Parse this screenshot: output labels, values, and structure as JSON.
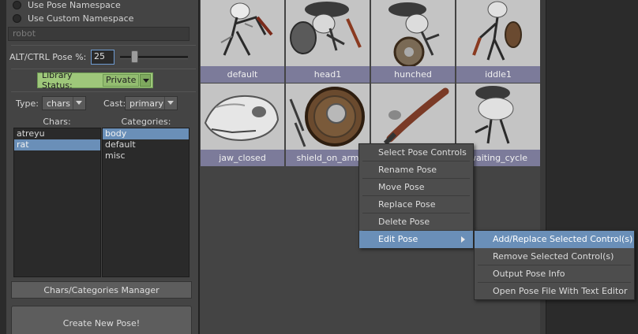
{
  "options": {
    "use_pose_namespace": "Use Pose Namespace",
    "use_custom_namespace": "Use Custom Namespace",
    "namespace_placeholder": "robot"
  },
  "alt_ctrl": {
    "label": "ALT/CTRL Pose %:",
    "value": "25",
    "slider_fraction": 0.25
  },
  "library_status": {
    "label": "Library Status:",
    "value": "Private",
    "color": "#9ec77a"
  },
  "filters": {
    "type_label": "Type:",
    "type_value": "chars",
    "cast_label": "Cast:",
    "cast_value": "primary"
  },
  "chars": {
    "header": "Chars:",
    "items": [
      "atreyu",
      "rat"
    ],
    "selected": "rat"
  },
  "categories": {
    "header": "Categories:",
    "items": [
      "body",
      "default",
      "misc"
    ],
    "selected": "body"
  },
  "buttons": {
    "manager": "Chars/Categories Manager",
    "create": "Create New Pose!"
  },
  "poses": [
    {
      "label": "default"
    },
    {
      "label": "head1"
    },
    {
      "label": "hunched"
    },
    {
      "label": "iddle1"
    },
    {
      "label": "jaw_closed"
    },
    {
      "label": "shield_on_arm"
    },
    {
      "label": ""
    },
    {
      "label": "waiting_cycle"
    }
  ],
  "context_menu": {
    "items": [
      "Select Pose Controls",
      "Rename Pose",
      "Move Pose",
      "Replace Pose",
      "Delete Pose",
      "Edit Pose"
    ],
    "highlighted": "Edit Pose"
  },
  "submenu": {
    "items": [
      "Add/Replace Selected Control(s)",
      "Remove Selected Control(s)",
      "Output Pose Info",
      "Open Pose File With Text Editor"
    ],
    "highlighted": "Add/Replace Selected Control(s)"
  },
  "colors": {
    "selection": "#6a8fb8",
    "tile_label_bg": "#7c7b9a",
    "panel_bg": "#444444"
  }
}
